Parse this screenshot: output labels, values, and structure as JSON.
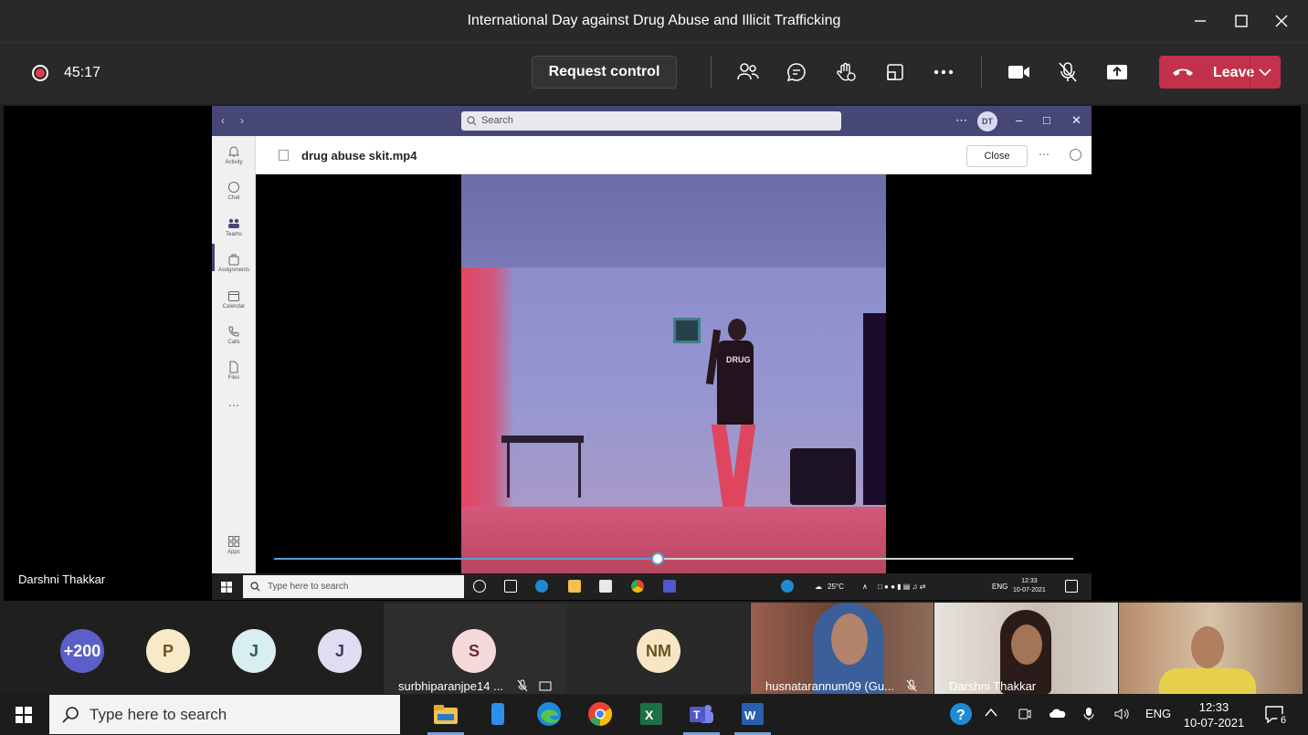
{
  "window": {
    "title": "International Day against Drug Abuse and Illicit Trafficking",
    "minimize_icon": "minimize-icon",
    "maximize_icon": "maximize-icon",
    "close_icon": "close-icon"
  },
  "toolbar": {
    "recording_timer": "45:17",
    "request_control_label": "Request control",
    "leave_label": "Leave",
    "icons": [
      "people-icon",
      "chat-icon",
      "raise-hand-icon",
      "view-icon",
      "more-icon",
      "camera-icon",
      "mic-off-icon",
      "share-icon"
    ],
    "leave_color": "#c4314b"
  },
  "presenter": {
    "name": "Darshni Thakkar"
  },
  "shared_screen": {
    "search_placeholder": "Search",
    "user_initials": "DT",
    "file_name": "drug abuse skit.mp4",
    "close_label": "Close",
    "rail": [
      {
        "label": "Activity",
        "icon": "bell-icon"
      },
      {
        "label": "Chat",
        "icon": "chat-icon"
      },
      {
        "label": "Teams",
        "icon": "teams-icon"
      },
      {
        "label": "Assignments",
        "icon": "assignments-icon"
      },
      {
        "label": "Calendar",
        "icon": "calendar-icon"
      },
      {
        "label": "Calls",
        "icon": "phone-icon"
      },
      {
        "label": "Files",
        "icon": "file-icon"
      },
      {
        "label": "Apps",
        "icon": "apps-icon"
      }
    ],
    "shirt_text": "DRUG",
    "playback_progress": 0.48,
    "taskbar": {
      "search_placeholder": "Type here to search",
      "temperature": "25°C",
      "language": "ENG",
      "time": "12:33",
      "date": "10-07-2021"
    }
  },
  "participants": {
    "overflow_count": "+200",
    "avatars": [
      {
        "initial": "P",
        "bg": "#f8e9c8",
        "fg": "#6b5420"
      },
      {
        "initial": "J",
        "bg": "#d8eef0",
        "fg": "#2b5c63"
      },
      {
        "initial": "J",
        "bg": "#e0dcf2",
        "fg": "#3e3a6b"
      }
    ],
    "overflow_bg": "#5b5fc7",
    "tiles": [
      {
        "initial": "S",
        "name": "surbhiparanjpe14 ...",
        "bg": "#f6d9da",
        "fg": "#6c2a31"
      },
      {
        "initial": "NM",
        "name": "",
        "bg": "#f7e6c4",
        "fg": "#6b5420"
      }
    ],
    "video_tiles": [
      {
        "name": "husnatarannum09 (Gu..."
      },
      {
        "name": "Darshni Thakkar"
      },
      {
        "name": ""
      }
    ]
  },
  "taskbar": {
    "search_placeholder": "Type here to search",
    "language": "ENG",
    "time": "12:33",
    "date": "10-07-2021",
    "notification_count": "6"
  }
}
